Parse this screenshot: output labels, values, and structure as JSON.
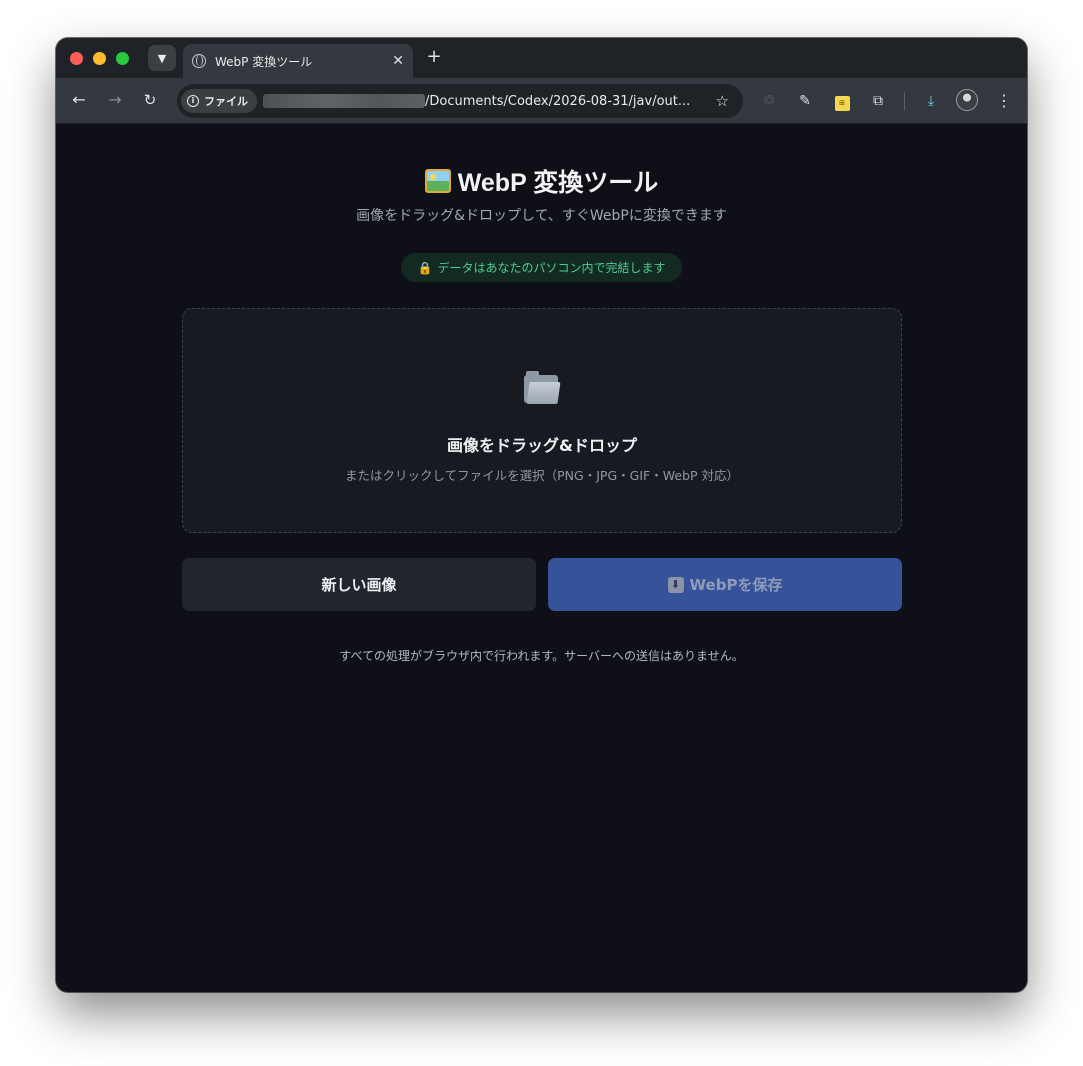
{
  "browser": {
    "tab": {
      "title": "WebP 変換ツール"
    },
    "new_tab_label": "+",
    "close_label": "✕",
    "address": {
      "chip_label": "ファイル",
      "url_visible": "/Documents/Codex/2026-08-31/jav/out..."
    },
    "icons": {
      "back": "←",
      "forward": "→",
      "reload": "↻",
      "star": "☆",
      "menu": "⋮",
      "download": "⤓",
      "extensions": "⧉",
      "dropper": "✎",
      "recycle": "♲",
      "note": "⊞"
    },
    "accent": "#7cc4f5"
  },
  "page": {
    "title": "WebP 変換ツール",
    "subtitle": "画像をドラッグ&ドロップして、すぐWebPに変換できます",
    "privacy_badge": "データはあなたのパソコン内で完結します",
    "dropzone": {
      "title": "画像をドラッグ&ドロップ",
      "hint": "またはクリックしてファイルを選択（PNG・JPG・GIF・WebP 対応）"
    },
    "buttons": {
      "new_image": "新しい画像",
      "save_webp": "WebPを保存"
    },
    "footer_note": "すべての処理がブラウザ内で行われます。サーバーへの送信はありません。",
    "colors": {
      "background": "#0f1017",
      "save_button": "#365399",
      "badge_text": "#4ecc8f"
    }
  }
}
